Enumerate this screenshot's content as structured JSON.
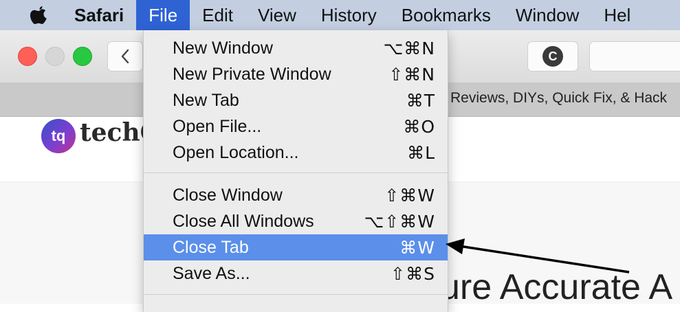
{
  "menubar": {
    "app_name": "Safari",
    "items": [
      "File",
      "Edit",
      "View",
      "History",
      "Bookmarks",
      "Window",
      "Hel"
    ]
  },
  "toolbar": {
    "extension_letter": "C"
  },
  "tab": {
    "title": "Reviews, DIYs, Quick Fix, & Hack"
  },
  "site": {
    "logo_initials": "tq",
    "logo_text": "techQ",
    "headline": "ure Accurate A"
  },
  "file_menu": {
    "items": [
      {
        "label": "New Window",
        "shortcut": "⌥⌘N"
      },
      {
        "label": "New Private Window",
        "shortcut": "⇧⌘N"
      },
      {
        "label": "New Tab",
        "shortcut": "⌘T"
      },
      {
        "label": "Open File...",
        "shortcut": "⌘O"
      },
      {
        "label": "Open Location...",
        "shortcut": "⌘L"
      },
      {
        "label": "Close Window",
        "shortcut": "⇧⌘W"
      },
      {
        "label": "Close All Windows",
        "shortcut": "⌥⇧⌘W"
      },
      {
        "label": "Close Tab",
        "shortcut": "⌘W"
      },
      {
        "label": "Save As...",
        "shortcut": "⇧⌘S"
      }
    ],
    "highlighted_item": "Close Tab"
  },
  "colors": {
    "menubar": "#c3cfe1",
    "active_menu": "#2f63d4",
    "highlight": "#5b8fea"
  }
}
